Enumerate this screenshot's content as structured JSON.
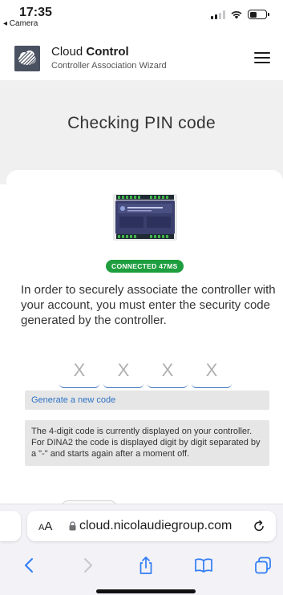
{
  "status_bar": {
    "time": "17:35",
    "back_app": "◂ Camera"
  },
  "header": {
    "brand_prefix": "Cloud ",
    "brand_bold": "Control",
    "subtitle": "Controller Association Wizard"
  },
  "hero": {
    "title": "Checking PIN code"
  },
  "connection": {
    "badge": "CONNECTED 47MS",
    "color": "#1e9e3e"
  },
  "instructions": "In order to securely associate the controller with your account, you must enter the security code generated by the controller.",
  "pin": {
    "placeholders": [
      "X",
      "X",
      "X",
      "X"
    ]
  },
  "generate_label": "Generate a new code",
  "info_text": "The 4-digit code is currently displayed on your controller. For DINA2 the code is displayed digit by digit separated by a \"-\" and starts again after a moment off.",
  "browser": {
    "aa_label": "AA",
    "url": "cloud.nicolaudiegroup.com"
  },
  "colors": {
    "accent": "#2d72c4",
    "success": "#1e9e3e",
    "panel": "#e6e6e6",
    "hero_bg": "#f0f0f0"
  }
}
